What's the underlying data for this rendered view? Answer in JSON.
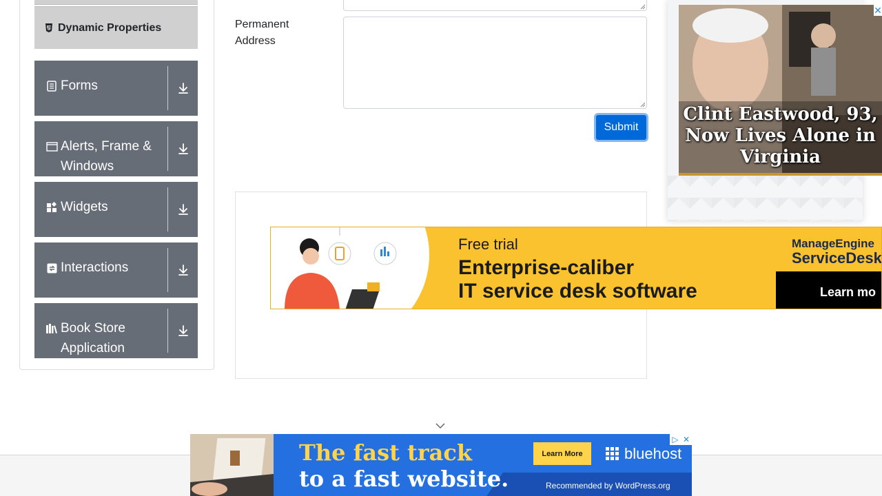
{
  "sidebar": {
    "active_item": {
      "label": "Dynamic Properties",
      "icon": "html5-shield-icon"
    },
    "groups": [
      {
        "label": "Forms",
        "icon": "document-icon"
      },
      {
        "label": "Alerts, Frame & Windows",
        "icon": "window-icon"
      },
      {
        "label": "Widgets",
        "icon": "widgets-icon"
      },
      {
        "label": "Interactions",
        "icon": "interaction-arrows-icon"
      },
      {
        "label": "Book Store Application",
        "icon": "books-icon"
      }
    ]
  },
  "form": {
    "permanent_address_label": "Permanent Address",
    "permanent_address_value": "",
    "submit_label": "Submit"
  },
  "ads": {
    "side": {
      "headline": "Clint Eastwood, 93, Now Lives Alone in Virginia",
      "close": "✕"
    },
    "banner": {
      "free": "Free trial",
      "line1": "Enterprise-caliber",
      "line2": "IT service desk software",
      "brand_top": "ManageEngine",
      "brand_bottom": "ServiceDesk",
      "cta": "Learn mo"
    },
    "bottom": {
      "line1": "The fast track",
      "line2": "to a fast website.",
      "cta": "Learn More",
      "brand": "bluehost",
      "recommended": "Recommended by WordPress.org",
      "adchoices": "▷",
      "close": "✕"
    }
  },
  "colors": {
    "sidebar_group_bg": "#666d76",
    "active_item_bg": "#d0d0d0",
    "submit_bg": "#0069d9",
    "banner_bg": "#f9c22e",
    "bottom_ad_bg": "#2470e0"
  }
}
